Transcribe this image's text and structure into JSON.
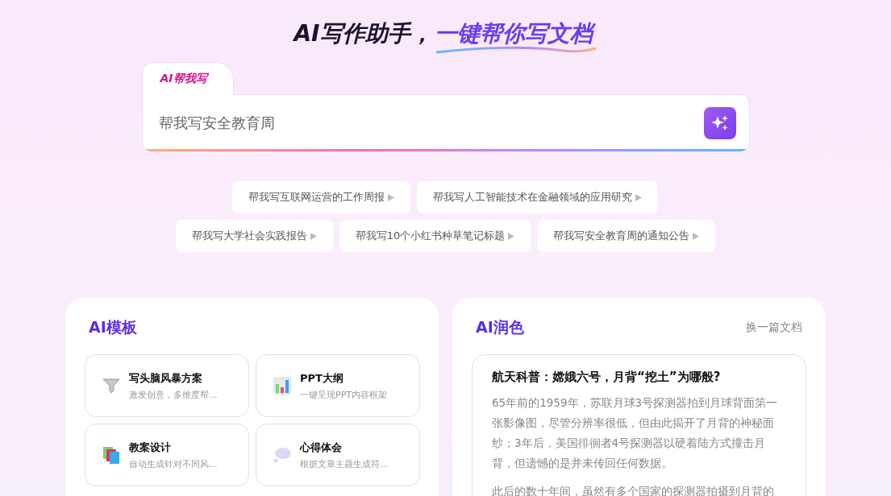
{
  "header": {
    "title": "AI写作助手，",
    "highlight": "一键帮你写文档"
  },
  "composer": {
    "tab": "AI帮我写",
    "value": "帮我写安全教育周"
  },
  "suggestions": [
    [
      "帮我写互联网运营的工作周报",
      "帮我写人工智能技术在金融领域的应用研究"
    ],
    [
      "帮我写大学社会实践报告",
      "帮我写10个小红书种草笔记标题",
      "帮我写安全教育周的通知公告"
    ]
  ],
  "templates": {
    "title": "AI模板",
    "items": [
      {
        "kind": "funnel",
        "title": "写头脑风暴方案",
        "desc": "激发创意，多维度帮..."
      },
      {
        "kind": "chart",
        "title": "PPT大纲",
        "desc": "一键呈现PPT内容框架"
      },
      {
        "kind": "books",
        "title": "教案设计",
        "desc": "自动生成针对不同风..."
      },
      {
        "kind": "bubble",
        "title": "心得体会",
        "desc": "根据文章主题生成符..."
      }
    ]
  },
  "polish": {
    "title": "AI润色",
    "action": "换一篇文档",
    "article_title": "航天科普：嫦娥六号，月背“挖土”为哪般?",
    "paragraphs": [
      "65年前的1959年，苏联月球3号探测器拍到月球背面第一张影像图，尽管分辨率很低，但由此揭开了月背的神秘面纱；3年后，美国徘徊者4号探测器以硬着陆方式撞击月背，但遗憾的是并未传回任何数据。",
      "此后的数十年间，虽然有多个国家的探测器拍摄到月背的"
    ]
  }
}
